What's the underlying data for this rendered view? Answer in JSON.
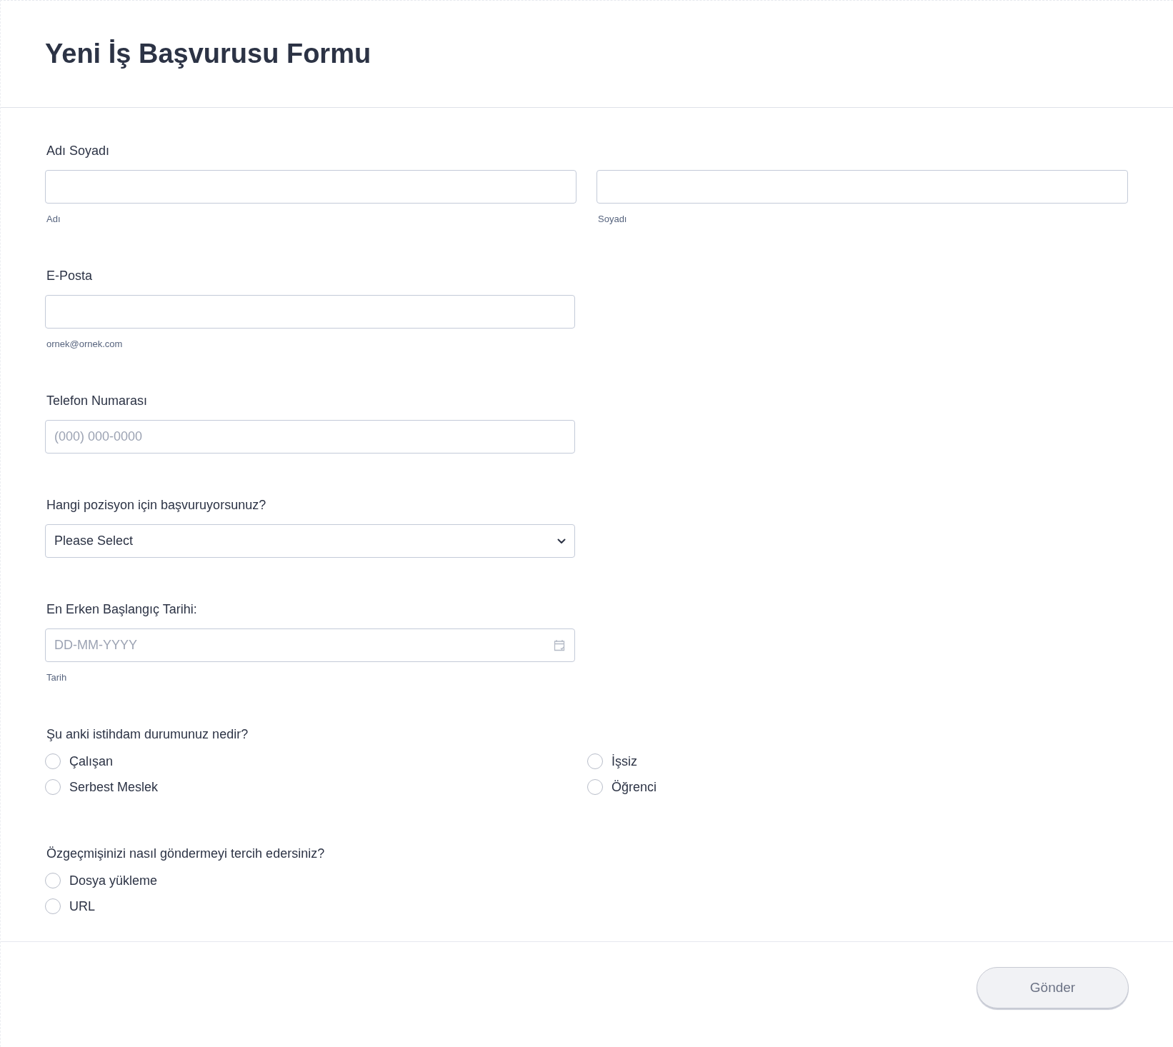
{
  "title": "Yeni İş Başvurusu Formu",
  "fields": [
    {
      "kind": "name",
      "label": "Adı Soyadı",
      "inputs": [
        {
          "sublabel": "Adı"
        },
        {
          "sublabel": "Soyadı"
        }
      ]
    },
    {
      "kind": "text",
      "label": "E-Posta",
      "sublabel": "ornek@ornek.com"
    },
    {
      "kind": "text",
      "label": "Telefon Numarası",
      "placeholder": "(000) 000-0000"
    },
    {
      "kind": "select",
      "label": "Hangi pozisyon için başvuruyorsunuz?",
      "value": "Please Select"
    },
    {
      "kind": "date",
      "label": "En Erken Başlangıç Tarihi:",
      "placeholder": "DD-MM-YYYY",
      "sublabel": "Tarih"
    },
    {
      "kind": "radio",
      "label": "Şu anki istihdam durumunuz nedir?",
      "options": [
        {
          "label": "Çalışan",
          "selected": false
        },
        {
          "label": "İşsiz",
          "selected": false
        },
        {
          "label": "Serbest Meslek",
          "selected": false
        },
        {
          "label": "Öğrenci",
          "selected": false
        }
      ]
    },
    {
      "kind": "radio",
      "label": "Özgeçmişinizi nasıl göndermeyi tercih edersiniz?",
      "options": [
        {
          "label": "Dosya yükleme",
          "selected": false
        },
        {
          "label": "URL",
          "selected": false
        }
      ]
    }
  ],
  "submit": "Gönder"
}
